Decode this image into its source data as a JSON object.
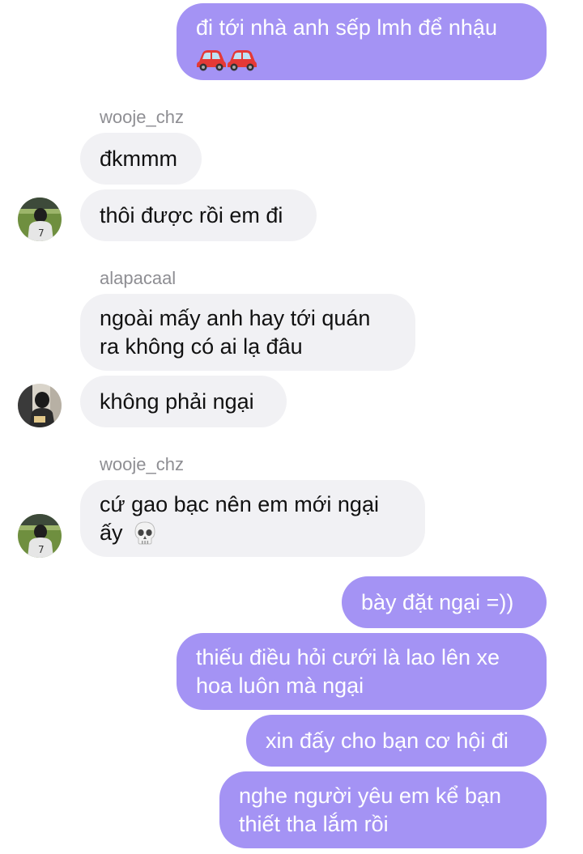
{
  "messages": [
    {
      "text": "đi tới nhà anh sếp lmh để nhậu",
      "emoji": "red-car red-car"
    },
    {
      "sender": "wooje_chz"
    },
    {
      "text": "đkmmm"
    },
    {
      "text": "thôi được rồi em đi"
    },
    {
      "sender": "alapacaal"
    },
    {
      "text": "ngoài mấy anh hay tới quán",
      "text2": "ra không có ai lạ đâu"
    },
    {
      "text": "không phải ngại"
    },
    {
      "sender": "wooje_chz"
    },
    {
      "text": "cứ gao bạc nên em mới ngại",
      "text2": "ấy",
      "emoji": "skull"
    },
    {
      "text": "bày đặt ngại =))"
    },
    {
      "text": "thiếu điều hỏi cưới là lao lên xe",
      "text2": "hoa luôn mà ngại"
    },
    {
      "text": "xin đấy cho bạn cơ hội đi"
    },
    {
      "text": "nghe người yêu em kể bạn",
      "text2": "thiết tha lắm rồi"
    }
  ],
  "colors": {
    "outgoing_bubble": "#a493f4",
    "incoming_bubble": "#f1f1f4",
    "sender_name": "#8e8e93"
  }
}
